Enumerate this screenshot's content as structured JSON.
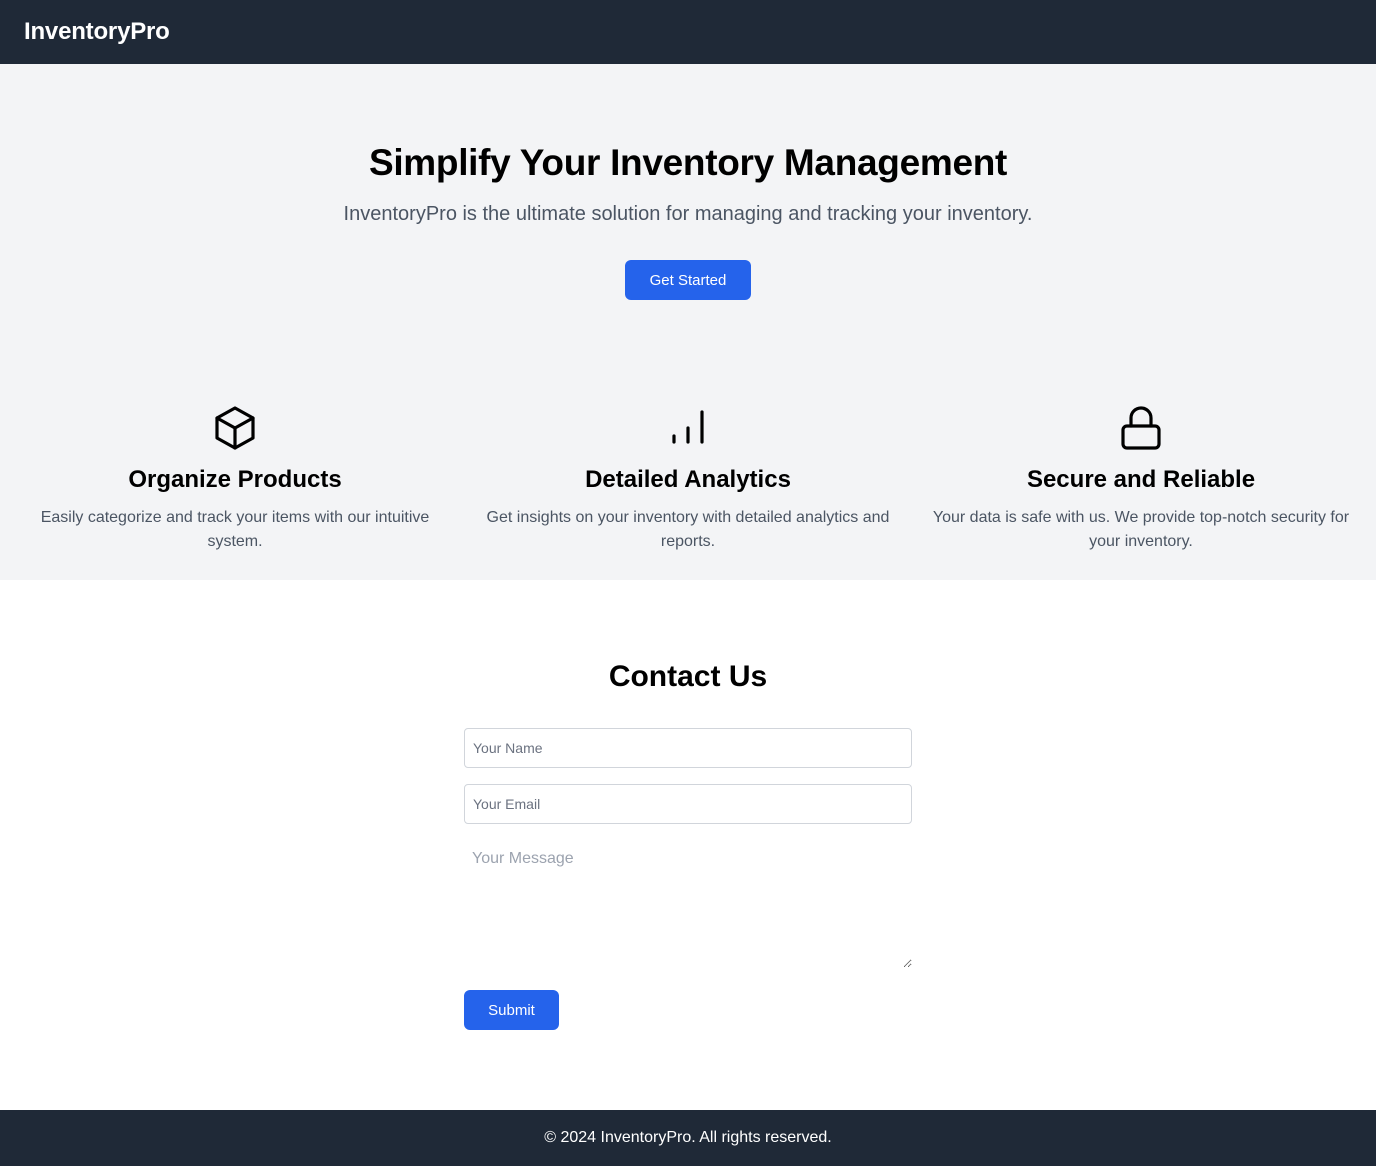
{
  "header": {
    "brand": "InventoryPro"
  },
  "hero": {
    "title": "Simplify Your Inventory Management",
    "subtitle": "InventoryPro is the ultimate solution for managing and tracking your inventory.",
    "cta_label": "Get Started"
  },
  "features": [
    {
      "icon": "cube-icon",
      "title": "Organize Products",
      "description": "Easily categorize and track your items with our intuitive system."
    },
    {
      "icon": "bar-chart-icon",
      "title": "Detailed Analytics",
      "description": "Get insights on your inventory with detailed analytics and reports."
    },
    {
      "icon": "lock-icon",
      "title": "Secure and Reliable",
      "description": "Your data is safe with us. We provide top-notch security for your inventory."
    }
  ],
  "contact": {
    "title": "Contact Us",
    "name_placeholder": "Your Name",
    "email_placeholder": "Your Email",
    "message_placeholder": "Your Message",
    "submit_label": "Submit"
  },
  "footer": {
    "text": "© 2024 InventoryPro. All rights reserved."
  },
  "colors": {
    "nav_bg": "#1f2937",
    "hero_bg": "#f3f4f6",
    "accent": "#2563eb"
  }
}
